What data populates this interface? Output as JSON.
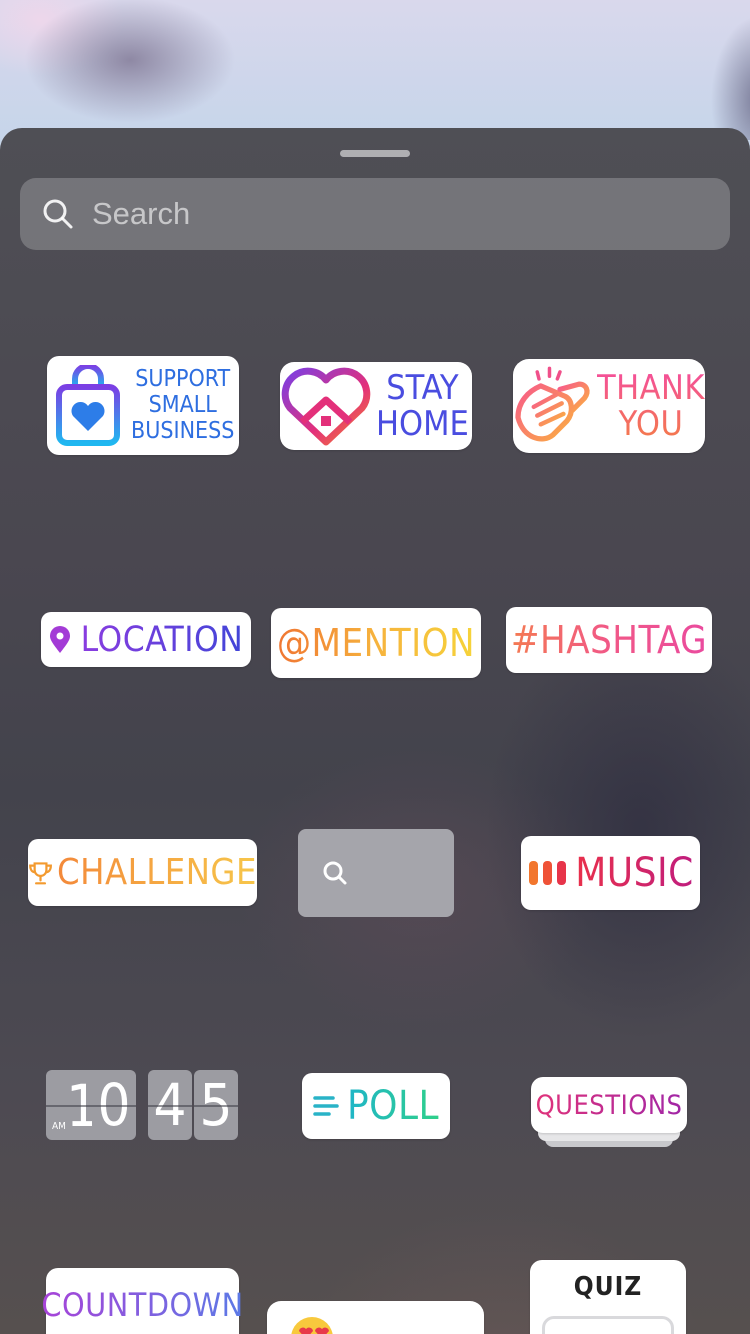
{
  "search": {
    "placeholder": "Search"
  },
  "stickers": {
    "support_small_business": [
      "SUPPORT",
      "SMALL",
      "BUSINESS"
    ],
    "stay_home": [
      "STAY",
      "HOME"
    ],
    "thank_you": [
      "THANK",
      "YOU"
    ],
    "location": "LOCATION",
    "mention": "@MENTION",
    "hashtag": "#HASHTAG",
    "challenge": "CHALLENGE",
    "music": "MUSIC",
    "clock": {
      "ampm": "AM",
      "h1": "1",
      "h2": "0",
      "m1": "4",
      "m2": "5"
    },
    "poll": "POLL",
    "questions": "QUESTIONS",
    "countdown": "COUNTDOWN",
    "quiz": "QUIZ"
  },
  "colors": {
    "blue_gradient": [
      "#2d6de6",
      "#6a3ce0"
    ],
    "ig_gradient": [
      "#f58529",
      "#dd2a7b",
      "#8134af"
    ],
    "accent_purple": "#7c3aed"
  }
}
